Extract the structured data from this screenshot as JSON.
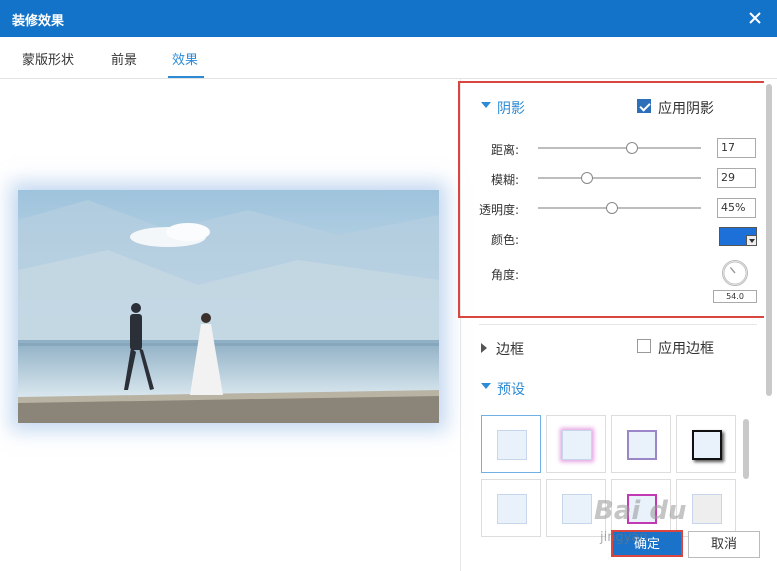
{
  "window": {
    "title": "装修效果"
  },
  "tabs": [
    {
      "label": "蒙版形状"
    },
    {
      "label": "前景"
    },
    {
      "label": "效果"
    }
  ],
  "shadow": {
    "section_label": "阴影",
    "apply_label": "应用阴影",
    "apply_checked": true,
    "distance_label": "距离:",
    "distance_value": "17",
    "blur_label": "模糊:",
    "blur_value": "29",
    "opacity_label": "透明度:",
    "opacity_value": "45%",
    "color_label": "颜色:",
    "color_value": "#1c70d8",
    "angle_label": "角度:",
    "angle_value": "54.0"
  },
  "border": {
    "section_label": "边框",
    "apply_label": "应用边框",
    "apply_checked": false
  },
  "presets": {
    "section_label": "预设",
    "items": [
      {
        "name": "preset-plain",
        "selected": true
      },
      {
        "name": "preset-pink-glow"
      },
      {
        "name": "preset-purple-border"
      },
      {
        "name": "preset-dark-shadow"
      },
      {
        "name": "preset-light"
      },
      {
        "name": "preset-soft"
      },
      {
        "name": "preset-magenta-border"
      },
      {
        "name": "preset-gray"
      }
    ]
  },
  "buttons": {
    "ok": "确定",
    "cancel": "取消"
  },
  "watermark": {
    "text": "Bai du",
    "sub": "jingyan"
  },
  "colors": {
    "accent": "#1373c9",
    "highlight_box": "#d9453f",
    "active_tab": "#2d8bd6"
  }
}
